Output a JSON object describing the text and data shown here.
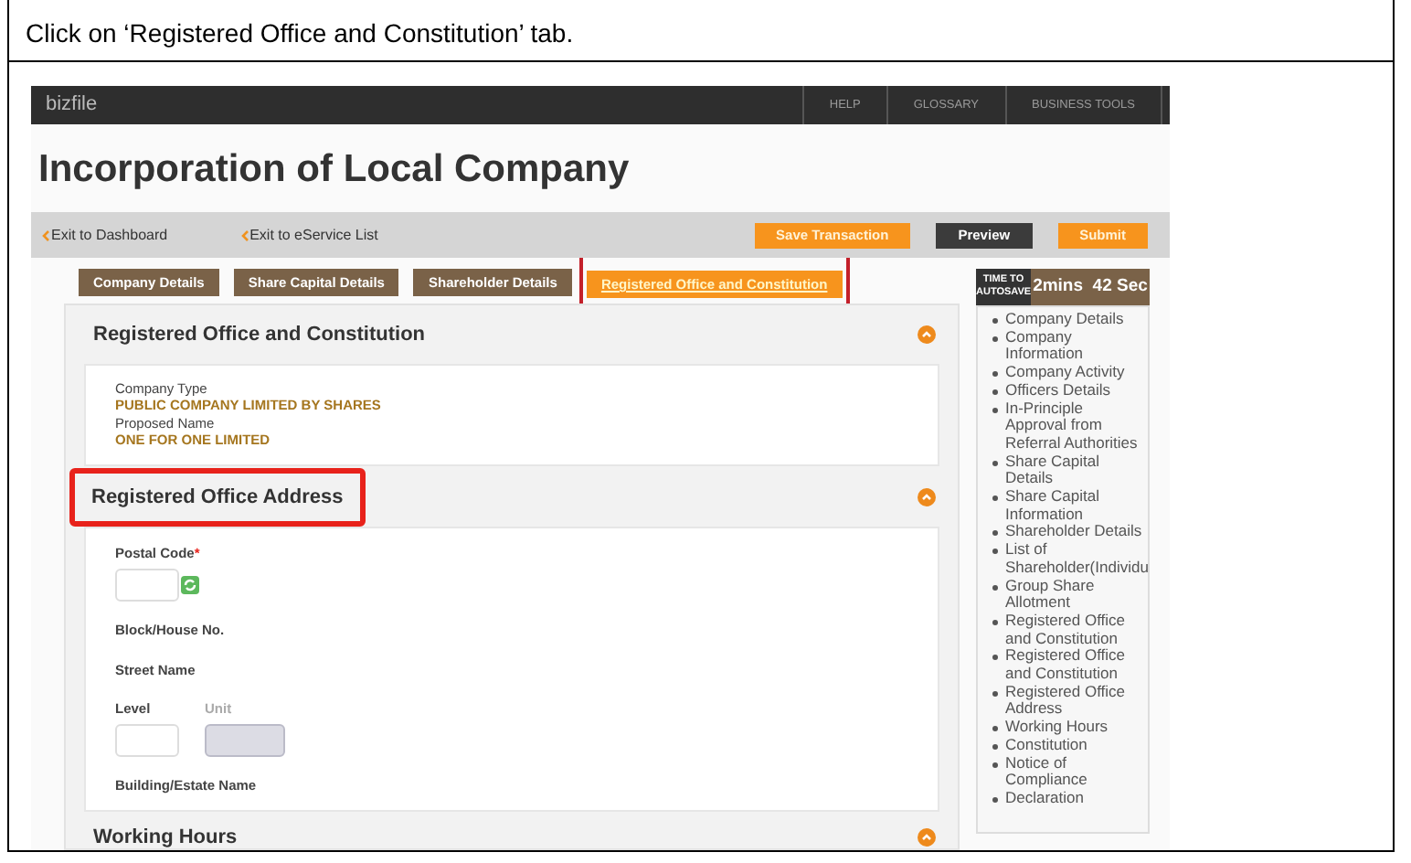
{
  "instruction": "Click on ‘Registered Office and Constitution’ tab.",
  "app": {
    "logo": "bizfile",
    "nav": [
      "HELP",
      "GLOSSARY",
      "BUSINESS TOOLS"
    ],
    "page_title": "Incorporation of Local Company",
    "links": [
      "Exit to Dashboard",
      "Exit to eService List"
    ],
    "buttons": [
      {
        "label": "Save Transaction",
        "kind": "primary"
      },
      {
        "label": "Preview",
        "kind": "dark"
      },
      {
        "label": "Submit",
        "kind": "primary"
      }
    ],
    "tabs": [
      {
        "label": "Company Details",
        "selected": false,
        "highlighted": false
      },
      {
        "label": "Share Capital Details",
        "selected": false,
        "highlighted": false
      },
      {
        "label": "Shareholder Details",
        "selected": false,
        "highlighted": false
      },
      {
        "label": "Registered Office and Constitution",
        "selected": true,
        "highlighted": true
      }
    ],
    "autosave": {
      "label": "TIME TO AUTOSAVE",
      "time": "2mins  42 Sec"
    },
    "sections": [
      {
        "title": "Registered Office and Constitution",
        "highlighted": false,
        "fields": [
          {
            "kind": "info",
            "label": "Company Type",
            "value": "PUBLIC COMPANY LIMITED BY SHARES"
          },
          {
            "kind": "info",
            "label": "Proposed Name",
            "value": "ONE FOR ONE LIMITED"
          }
        ]
      },
      {
        "title": "Registered Office Address",
        "highlighted": true,
        "fields": [
          {
            "kind": "input",
            "label": "Postal Code",
            "required_mark": "*"
          },
          {
            "kind": "label",
            "label": "Block/House No."
          },
          {
            "kind": "label",
            "label": "Street Name"
          },
          {
            "kind": "pair",
            "items": [
              {
                "label": "Level",
                "disabled": false
              },
              {
                "label": "Unit",
                "disabled": true
              }
            ]
          },
          {
            "kind": "label",
            "label": "Building/Estate Name"
          }
        ]
      },
      {
        "title": "Working Hours",
        "highlighted": false
      }
    ],
    "side_list": [
      "Company Details",
      "Company Information",
      "Company Activity",
      "Officers Details",
      "In-Principle Approval from Referral Authorities",
      "Share Capital Details",
      "Share Capital Information",
      "Shareholder Details",
      "List of Shareholder(Individu",
      "Group Share Allotment",
      "Registered Office and Constitution",
      "Registered Office and Constitution",
      "Registered Office Address",
      "Working Hours",
      "Constitution",
      "Notice of Compliance",
      "Declaration"
    ]
  }
}
